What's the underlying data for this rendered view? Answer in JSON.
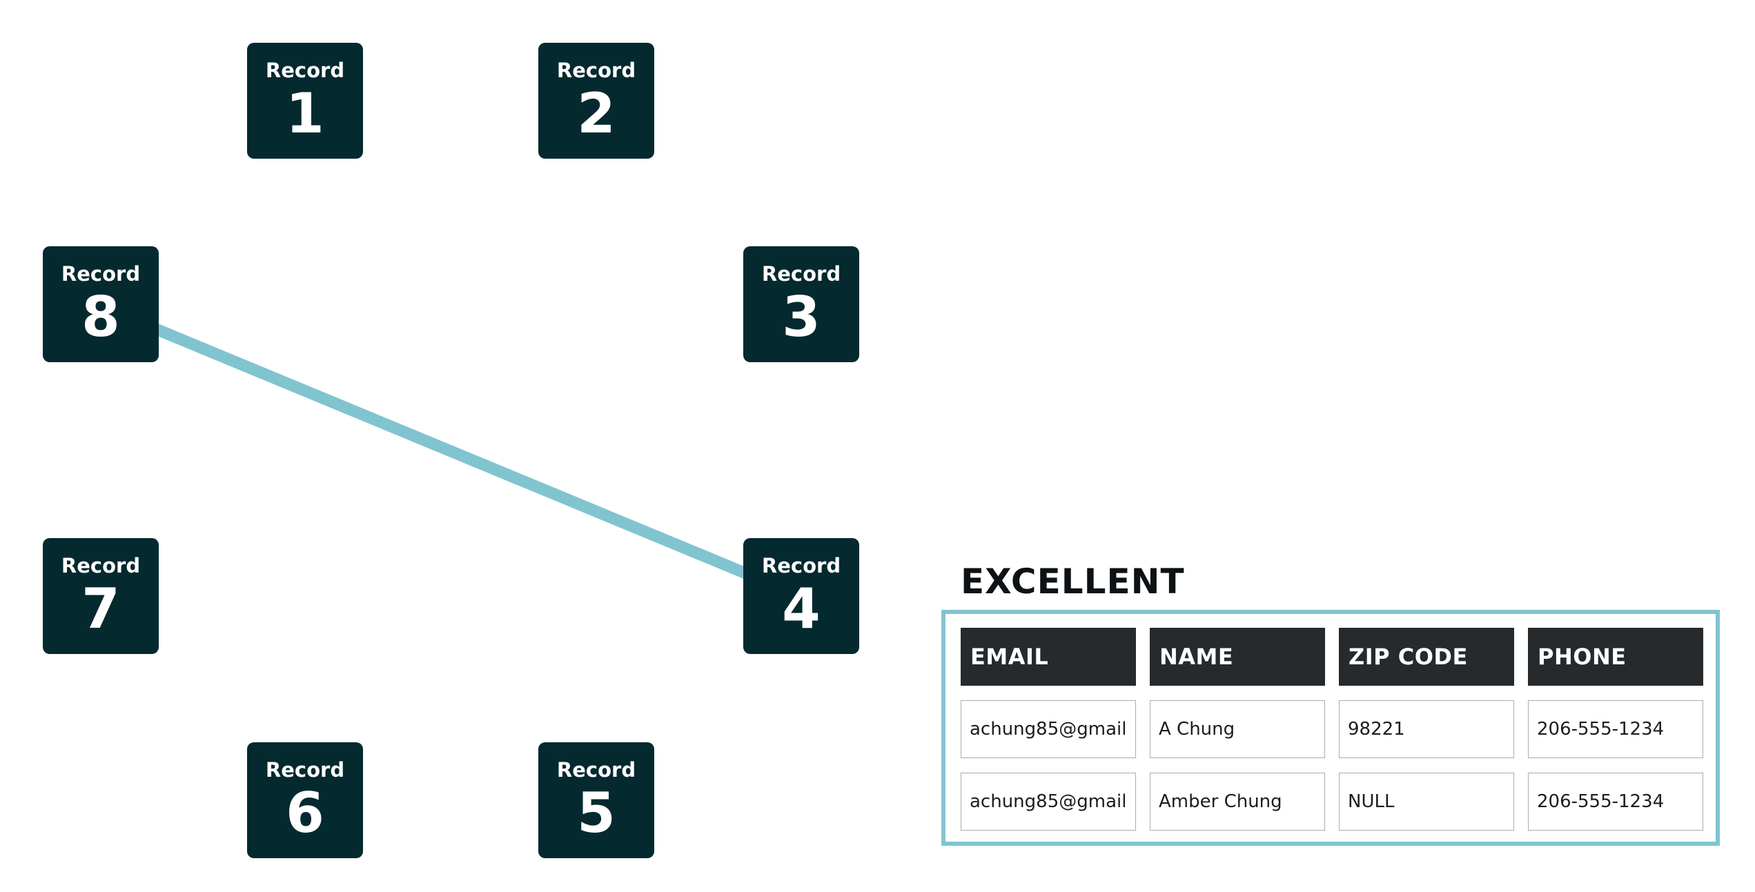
{
  "colors": {
    "node_fill": "#04292f",
    "node_text": "#ffffff",
    "connector": "#80c4cf",
    "table_frame": "#80c4cf",
    "table_header_fill": "#262a2d",
    "table_header_text": "#ffffff",
    "title_text": "#0d1214"
  },
  "records": [
    {
      "label": "Record",
      "number": "1"
    },
    {
      "label": "Record",
      "number": "2"
    },
    {
      "label": "Record",
      "number": "3"
    },
    {
      "label": "Record",
      "number": "4"
    },
    {
      "label": "Record",
      "number": "5"
    },
    {
      "label": "Record",
      "number": "6"
    },
    {
      "label": "Record",
      "number": "7"
    },
    {
      "label": "Record",
      "number": "8"
    }
  ],
  "connections": [
    {
      "from": "8",
      "to": "4"
    }
  ],
  "match_table": {
    "title": "EXCELLENT",
    "headers": [
      "EMAIL",
      "NAME",
      "ZIP CODE",
      "PHONE"
    ],
    "rows": [
      [
        "achung85@gmail",
        "A Chung",
        "98221",
        "206-555-1234"
      ],
      [
        "achung85@gmail",
        "Amber Chung",
        "NULL",
        "206-555-1234"
      ]
    ]
  }
}
